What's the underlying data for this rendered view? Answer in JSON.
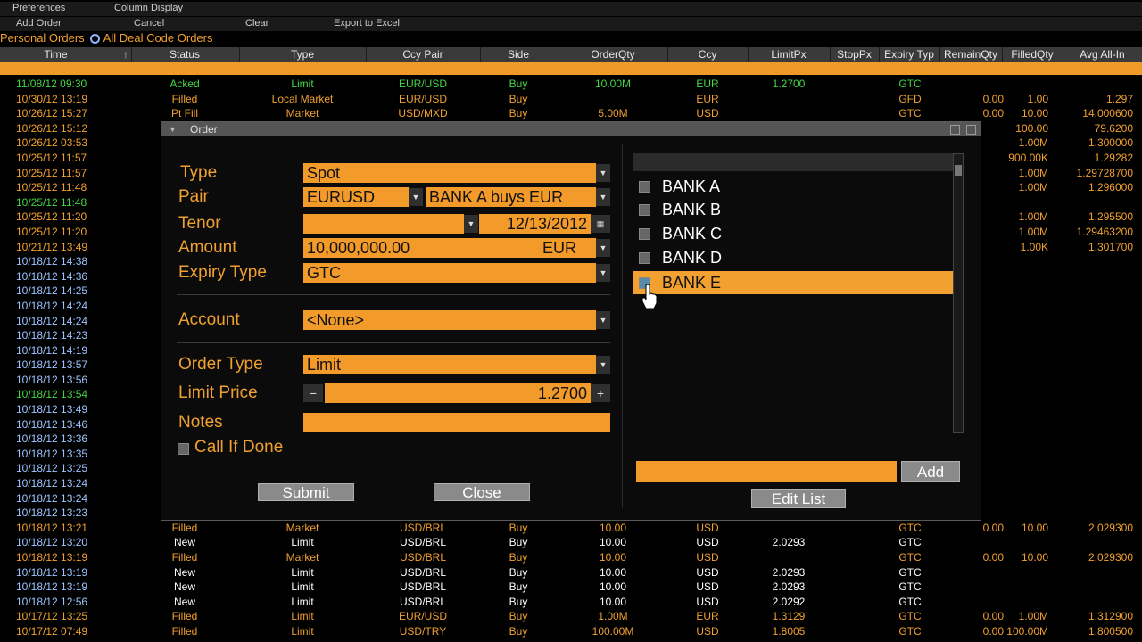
{
  "menus": {
    "row1": [
      "Preferences",
      "Column Display"
    ],
    "row2": [
      "Add Order",
      "Cancel",
      "Clear",
      "Export to Excel"
    ]
  },
  "viewbar": {
    "personal": "Personal Orders",
    "all": "All Deal Code Orders"
  },
  "columns": [
    "Time",
    "Status",
    "Type",
    "Ccy Pair",
    "Side",
    "OrderQty",
    "Ccy",
    "LimitPx",
    "StopPx",
    "Expiry Typ",
    "RemainQty",
    "FilledQty",
    "Avg All-In"
  ],
  "rows": [
    {
      "time": "11/08/12 09:30",
      "status": "Acked",
      "type": "Limit",
      "pair": "EUR/USD",
      "side": "Buy",
      "qty": "10.00M",
      "ccy": "EUR",
      "lpx": "1.2700",
      "exp": "GTC",
      "rem": "",
      "fill": "",
      "avg": "",
      "color": "green"
    },
    {
      "time": "10/30/12 13:19",
      "status": "Filled",
      "type": "Local Market",
      "pair": "EUR/USD",
      "side": "Buy",
      "qty": "",
      "ccy": "EUR",
      "lpx": "",
      "exp": "GFD",
      "rem": "0.00",
      "fill": "1.00",
      "avg": "1.297",
      "color": "orange"
    },
    {
      "time": "10/26/12 15:27",
      "status": "Pt Fill",
      "type": "Market",
      "pair": "USD/MXD",
      "side": "Buy",
      "qty": "5.00M",
      "ccy": "USD",
      "lpx": "",
      "exp": "GTC",
      "rem": "0.00",
      "fill": "10.00",
      "avg": "14.000600",
      "color": "orange"
    },
    {
      "time": "10/26/12 15:12",
      "status": "",
      "type": "",
      "pair": "",
      "side": "",
      "qty": "",
      "ccy": "",
      "lpx": "",
      "exp": "",
      "rem": "",
      "fill": "100.00",
      "avg": "79.6200",
      "color": "orange"
    },
    {
      "time": "10/26/12 03:53",
      "status": "",
      "type": "",
      "pair": "",
      "side": "",
      "qty": "",
      "ccy": "",
      "lpx": "",
      "exp": "",
      "rem": "",
      "fill": "1.00M",
      "avg": "1.300000",
      "color": "orange"
    },
    {
      "time": "10/25/12 11:57",
      "status": "",
      "type": "",
      "pair": "",
      "side": "",
      "qty": "",
      "ccy": "",
      "lpx": "",
      "exp": "",
      "rem": "",
      "fill": "900.00K",
      "avg": "1.29282",
      "color": "orange"
    },
    {
      "time": "10/25/12 11:57",
      "status": "",
      "type": "",
      "pair": "",
      "side": "",
      "qty": "",
      "ccy": "",
      "lpx": "",
      "exp": "",
      "rem": "",
      "fill": "1.00M",
      "avg": "1.29728700",
      "color": "orange"
    },
    {
      "time": "10/25/12 11:48",
      "status": "",
      "type": "",
      "pair": "",
      "side": "",
      "qty": "",
      "ccy": "",
      "lpx": "",
      "exp": "",
      "rem": "",
      "fill": "1.00M",
      "avg": "1.296000",
      "color": "orange"
    },
    {
      "time": "10/25/12 11:48",
      "status": "",
      "type": "",
      "pair": "",
      "side": "",
      "qty": "",
      "ccy": "",
      "lpx": "",
      "exp": "",
      "rem": "",
      "fill": "",
      "avg": "",
      "color": "green"
    },
    {
      "time": "10/25/12 11:20",
      "status": "",
      "type": "",
      "pair": "",
      "side": "",
      "qty": "",
      "ccy": "",
      "lpx": "",
      "exp": "",
      "rem": "",
      "fill": "1.00M",
      "avg": "1.295500",
      "color": "orange"
    },
    {
      "time": "10/25/12 11:20",
      "status": "",
      "type": "",
      "pair": "",
      "side": "",
      "qty": "",
      "ccy": "",
      "lpx": "",
      "exp": "",
      "rem": "",
      "fill": "1.00M",
      "avg": "1.29463200",
      "color": "orange"
    },
    {
      "time": "10/21/12 13:49",
      "status": "",
      "type": "",
      "pair": "",
      "side": "",
      "qty": "",
      "ccy": "",
      "lpx": "",
      "exp": "",
      "rem": "",
      "fill": "1.00K",
      "avg": "1.301700",
      "color": "orange"
    },
    {
      "time": "10/18/12 14:38",
      "status": "",
      "type": "",
      "pair": "",
      "side": "",
      "qty": "",
      "ccy": "",
      "lpx": "",
      "exp": "",
      "rem": "",
      "fill": "",
      "avg": "",
      "color": "blue"
    },
    {
      "time": "10/18/12 14:36",
      "status": "",
      "type": "",
      "pair": "",
      "side": "",
      "qty": "",
      "ccy": "",
      "lpx": "",
      "exp": "",
      "rem": "",
      "fill": "",
      "avg": "",
      "color": "blue"
    },
    {
      "time": "10/18/12 14:25",
      "status": "",
      "type": "",
      "pair": "",
      "side": "",
      "qty": "",
      "ccy": "",
      "lpx": "",
      "exp": "",
      "rem": "",
      "fill": "",
      "avg": "",
      "color": "blue"
    },
    {
      "time": "10/18/12 14:24",
      "status": "",
      "type": "",
      "pair": "",
      "side": "",
      "qty": "",
      "ccy": "",
      "lpx": "",
      "exp": "",
      "rem": "",
      "fill": "",
      "avg": "",
      "color": "blue"
    },
    {
      "time": "10/18/12 14:24",
      "status": "",
      "type": "",
      "pair": "",
      "side": "",
      "qty": "",
      "ccy": "",
      "lpx": "",
      "exp": "",
      "rem": "",
      "fill": "",
      "avg": "",
      "color": "blue"
    },
    {
      "time": "10/18/12 14:23",
      "status": "",
      "type": "",
      "pair": "",
      "side": "",
      "qty": "",
      "ccy": "",
      "lpx": "",
      "exp": "",
      "rem": "",
      "fill": "",
      "avg": "",
      "color": "blue"
    },
    {
      "time": "10/18/12 14:19",
      "status": "",
      "type": "",
      "pair": "",
      "side": "",
      "qty": "",
      "ccy": "",
      "lpx": "",
      "exp": "",
      "rem": "",
      "fill": "",
      "avg": "",
      "color": "blue"
    },
    {
      "time": "10/18/12 13:57",
      "status": "",
      "type": "",
      "pair": "",
      "side": "",
      "qty": "",
      "ccy": "",
      "lpx": "",
      "exp": "",
      "rem": "",
      "fill": "",
      "avg": "",
      "color": "blue"
    },
    {
      "time": "10/18/12 13:56",
      "status": "",
      "type": "",
      "pair": "",
      "side": "",
      "qty": "",
      "ccy": "",
      "lpx": "",
      "exp": "",
      "rem": "",
      "fill": "",
      "avg": "",
      "color": "blue"
    },
    {
      "time": "10/18/12 13:54",
      "status": "",
      "type": "",
      "pair": "",
      "side": "",
      "qty": "",
      "ccy": "",
      "lpx": "",
      "exp": "",
      "rem": "",
      "fill": "",
      "avg": "",
      "color": "green"
    },
    {
      "time": "10/18/12 13:49",
      "status": "",
      "type": "",
      "pair": "",
      "side": "",
      "qty": "",
      "ccy": "",
      "lpx": "",
      "exp": "",
      "rem": "",
      "fill": "",
      "avg": "",
      "color": "blue"
    },
    {
      "time": "10/18/12 13:46",
      "status": "",
      "type": "",
      "pair": "",
      "side": "",
      "qty": "",
      "ccy": "",
      "lpx": "",
      "exp": "",
      "rem": "",
      "fill": "",
      "avg": "",
      "color": "blue"
    },
    {
      "time": "10/18/12 13:36",
      "status": "",
      "type": "",
      "pair": "",
      "side": "",
      "qty": "",
      "ccy": "",
      "lpx": "",
      "exp": "",
      "rem": "",
      "fill": "",
      "avg": "",
      "color": "blue"
    },
    {
      "time": "10/18/12 13:35",
      "status": "",
      "type": "",
      "pair": "",
      "side": "",
      "qty": "",
      "ccy": "",
      "lpx": "",
      "exp": "",
      "rem": "",
      "fill": "",
      "avg": "",
      "color": "blue"
    },
    {
      "time": "10/18/12 13:25",
      "status": "",
      "type": "",
      "pair": "",
      "side": "",
      "qty": "",
      "ccy": "",
      "lpx": "",
      "exp": "",
      "rem": "",
      "fill": "",
      "avg": "",
      "color": "blue"
    },
    {
      "time": "10/18/12 13:24",
      "status": "",
      "type": "",
      "pair": "",
      "side": "",
      "qty": "",
      "ccy": "",
      "lpx": "",
      "exp": "",
      "rem": "",
      "fill": "",
      "avg": "",
      "color": "blue"
    },
    {
      "time": "10/18/12 13:24",
      "status": "",
      "type": "",
      "pair": "",
      "side": "",
      "qty": "",
      "ccy": "",
      "lpx": "",
      "exp": "",
      "rem": "",
      "fill": "",
      "avg": "",
      "color": "blue"
    },
    {
      "time": "10/18/12 13:23",
      "status": "",
      "type": "",
      "pair": "",
      "side": "",
      "qty": "",
      "ccy": "",
      "lpx": "",
      "exp": "",
      "rem": "",
      "fill": "",
      "avg": "",
      "color": "blue"
    },
    {
      "time": "10/18/12 13:21",
      "status": "Filled",
      "type": "Market",
      "pair": "USD/BRL",
      "side": "Buy",
      "qty": "10.00",
      "ccy": "USD",
      "lpx": "",
      "exp": "GTC",
      "rem": "0.00",
      "fill": "10.00",
      "avg": "2.029300",
      "color": "orange"
    },
    {
      "time": "10/18/12 13:20",
      "status": "New",
      "type": "Limit",
      "pair": "USD/BRL",
      "side": "Buy",
      "qty": "10.00",
      "ccy": "USD",
      "lpx": "2.0293",
      "exp": "GTC",
      "rem": "",
      "fill": "",
      "avg": "",
      "color": "blue"
    },
    {
      "time": "10/18/12 13:19",
      "status": "Filled",
      "type": "Market",
      "pair": "USD/BRL",
      "side": "Buy",
      "qty": "10.00",
      "ccy": "USD",
      "lpx": "",
      "exp": "GTC",
      "rem": "0.00",
      "fill": "10.00",
      "avg": "2.029300",
      "color": "orange"
    },
    {
      "time": "10/18/12 13:19",
      "status": "New",
      "type": "Limit",
      "pair": "USD/BRL",
      "side": "Buy",
      "qty": "10.00",
      "ccy": "USD",
      "lpx": "2.0293",
      "exp": "GTC",
      "rem": "",
      "fill": "",
      "avg": "",
      "color": "blue"
    },
    {
      "time": "10/18/12 13:19",
      "status": "New",
      "type": "Limit",
      "pair": "USD/BRL",
      "side": "Buy",
      "qty": "10.00",
      "ccy": "USD",
      "lpx": "2.0293",
      "exp": "GTC",
      "rem": "",
      "fill": "",
      "avg": "",
      "color": "blue"
    },
    {
      "time": "10/18/12 12:56",
      "status": "New",
      "type": "Limit",
      "pair": "USD/BRL",
      "side": "Buy",
      "qty": "10.00",
      "ccy": "USD",
      "lpx": "2.0292",
      "exp": "GTC",
      "rem": "",
      "fill": "",
      "avg": "",
      "color": "blue"
    },
    {
      "time": "10/17/12 13:25",
      "status": "Filled",
      "type": "Limit",
      "pair": "EUR/USD",
      "side": "Buy",
      "qty": "1.00M",
      "ccy": "EUR",
      "lpx": "1.3129",
      "exp": "GTC",
      "rem": "0.00",
      "fill": "1.00M",
      "avg": "1.312900",
      "color": "orange"
    },
    {
      "time": "10/17/12 07:49",
      "status": "Filled",
      "type": "Limit",
      "pair": "USD/TRY",
      "side": "Buy",
      "qty": "100.00M",
      "ccy": "USD",
      "lpx": "1.8005",
      "exp": "GTC",
      "rem": "0.00",
      "fill": "100.00M",
      "avg": "1.800500",
      "color": "orange"
    }
  ],
  "order_dialog": {
    "title": "Order",
    "labels": {
      "type": "Type",
      "pair": "Pair",
      "tenor": "Tenor",
      "amount": "Amount",
      "expiry": "Expiry Type",
      "account": "Account",
      "order_type": "Order Type",
      "limit_price": "Limit Price",
      "notes": "Notes",
      "call_if_done": "Call If Done"
    },
    "values": {
      "type": "Spot",
      "pair": "EURUSD",
      "direction": "BANK A buys EUR",
      "tenor": "12/13/2012",
      "amount": "10,000,000.00",
      "amount_ccy": "EUR",
      "expiry": "GTC",
      "account": "<None>",
      "order_type": "Limit",
      "limit_price": "1.2700",
      "notes": ""
    },
    "buttons": {
      "submit": "Submit",
      "close": "Close",
      "add": "Add",
      "edit_list": "Edit List"
    },
    "banks": [
      {
        "name": "BANK A",
        "selected": false
      },
      {
        "name": "BANK B",
        "selected": false
      },
      {
        "name": "BANK C",
        "selected": false
      },
      {
        "name": "BANK D",
        "selected": false
      },
      {
        "name": "BANK E",
        "selected": true
      }
    ],
    "add_field_value": ""
  },
  "colors": {
    "accent": "#f29a2a",
    "green": "#44d544",
    "blue": "#9cc4ff"
  }
}
